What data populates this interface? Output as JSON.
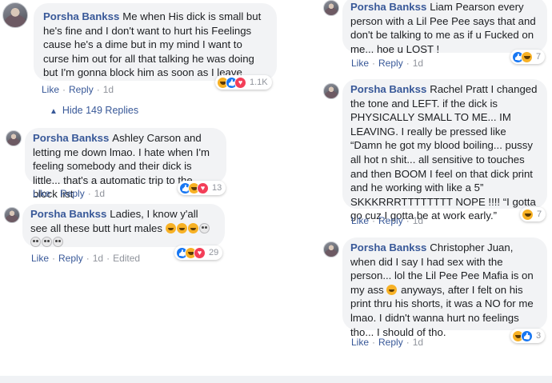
{
  "comments": [
    {
      "author": "Porsha Bankss",
      "text": "Me when His dick is small but he's fine and I don't want to hurt his Feelings cause he's a dime but in my mind I want to curse him out for all that talking he was doing but I'm gonna block him as soon as I leave",
      "like": "Like",
      "reply": "Reply",
      "time": "1d",
      "reaction_count": "1.1K"
    },
    {
      "author": "Porsha Bankss",
      "text": "Ashley Carson and letting me down lmao. I hate when I'm feeling somebody and their dick is little... that's a automatic trip to the block list",
      "like": "Like",
      "reply": "Reply",
      "time": "1d",
      "reaction_count": "13"
    },
    {
      "author": "Porsha Bankss",
      "text": "Ladies, I know y'all see all these butt hurt males",
      "like": "Like",
      "reply": "Reply",
      "time": "1d",
      "edited": "Edited",
      "reaction_count": "29"
    },
    {
      "author": "Porsha Bankss",
      "text": "Liam Pearson every person with a Lil Pee Pee says that and don't be talking to me as if u Fucked on me... hoe u LOST !",
      "like": "Like",
      "reply": "Reply",
      "time": "1d",
      "reaction_count": "7"
    },
    {
      "author": "Porsha Bankss",
      "text": "Rachel Pratt I changed the tone and LEFT. if the dick is PHYSICALLY SMALL TO ME... IM LEAVING. I really be pressed like “Damn he got my blood boiling... pussy all hot n shit... all sensitive to touches and then BOOM I feel on that dick print and he working with like a 5” SKKKRRRTTTTTTTT NOPE !!!! “I gotta go cuz I gotta be at work early.”",
      "like": "Like",
      "reply": "Reply",
      "time": "1d",
      "reaction_count": "7"
    },
    {
      "author": "Porsha Bankss",
      "text_before": "Christopher Juan, when did I say I had sex with the person... lol the Lil Pee Pee Mafia is on my ass",
      "text_after": "anyways, after I felt on his print thru his shorts, it was a NO for me lmao. I didn't wanna hurt no feelings tho... I should of tho.",
      "like": "Like",
      "reply": "Reply",
      "time": "1d",
      "reaction_count": "3"
    }
  ],
  "hide_replies": "Hide 149 Replies",
  "colors": {
    "link": "#385898",
    "bubble": "#f2f3f5",
    "haha": "#f7b125",
    "like": "#1877f2",
    "love": "#f33e58"
  }
}
